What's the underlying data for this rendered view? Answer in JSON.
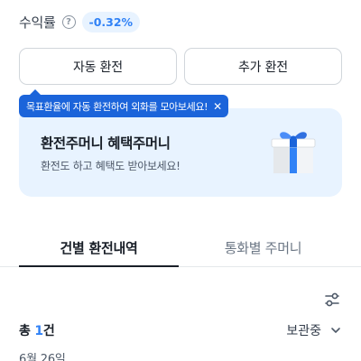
{
  "yield": {
    "label": "수익률",
    "help_icon": "?",
    "badge": "-0.32%"
  },
  "buttons": {
    "auto_exchange": "자동 환전",
    "add_exchange": "추가 환전"
  },
  "tooltip": {
    "text": "목표환율에 자동 환전하여 외화를 모아보세요!",
    "close": "✕"
  },
  "promo": {
    "title": "환전주머니 혜택주머니",
    "subtitle": "환전도 하고 혜택도 받아보세요!",
    "icon": "gift-icon"
  },
  "tabs": [
    {
      "label": "건별 환전내역",
      "active": true
    },
    {
      "label": "통화별 주머니",
      "active": false
    }
  ],
  "list": {
    "count_prefix": "총 ",
    "count": "1",
    "count_suffix": "건",
    "sort": "보관중",
    "date": "6월 26일"
  },
  "colors": {
    "accent": "#3182f6",
    "tooltip": "#1b64da",
    "promo_bg": "#e8f3ff"
  }
}
